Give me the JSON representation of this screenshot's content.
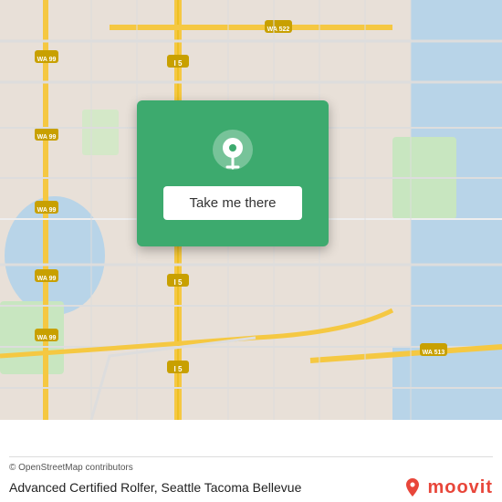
{
  "map": {
    "credit": "© OpenStreetMap contributors",
    "background_color": "#e8e0d8"
  },
  "overlay": {
    "button_label": "Take me there",
    "pin_icon": "location-pin-icon"
  },
  "footer": {
    "location_name": "Advanced Certified Rolfer,",
    "location_region": "Seattle Tacoma Bellevue",
    "moovit_label": "moovit",
    "moovit_icon": "moovit-pin-icon"
  }
}
